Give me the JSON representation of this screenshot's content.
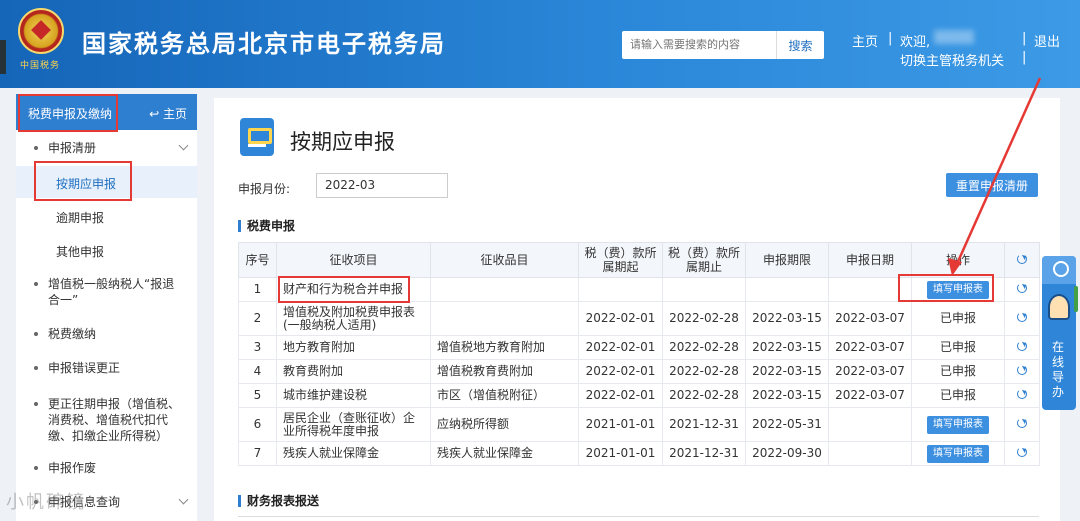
{
  "header": {
    "emblem_text": "中国税务",
    "site_title": "国家税务总局北京市电子税务局",
    "search_placeholder": "请输入需要搜索的内容",
    "search_button": "搜索",
    "home_link": "主页",
    "welcome": "欢迎,",
    "switch_authority": "切换主管税务机关",
    "logout": "退出",
    "separator": "|"
  },
  "sidebar": {
    "head_title": "税费申报及缴纳",
    "head_home": "主页",
    "items": [
      {
        "label": "申报清册"
      },
      {
        "label": "按期应申报"
      },
      {
        "label": "逾期申报"
      },
      {
        "label": "其他申报"
      },
      {
        "label": "增值税一般纳税人“报退合一”"
      },
      {
        "label": "税费缴纳"
      },
      {
        "label": "申报错误更正"
      },
      {
        "label": "更正往期申报（增值税、消费税、增值税代扣代缴、扣缴企业所得税）"
      },
      {
        "label": "申报作废"
      },
      {
        "label": "申报信息查询"
      }
    ],
    "watermark": "小帆碎镜"
  },
  "main": {
    "page_title": "按期应申报",
    "month_label": "申报月份:",
    "month_value": "2022-03",
    "reset_button": "重置申报清册",
    "section_tax": "税费申报",
    "section_finance": "财务报表报送",
    "columns": [
      "序号",
      "征收项目",
      "征收品目",
      "税（费）款所属期起",
      "税（费）款所属期止",
      "申报期限",
      "申报日期",
      "操作"
    ],
    "rows": [
      {
        "no": "1",
        "item": "财产和行为税合并申报",
        "sub": "",
        "start": "",
        "end": "",
        "deadline": "",
        "date": "",
        "action": "填写申报表",
        "action_type": "button"
      },
      {
        "no": "2",
        "item": "增值税及附加税费申报表(一般纳税人适用)",
        "sub": "",
        "start": "2022-02-01",
        "end": "2022-02-28",
        "deadline": "2022-03-15",
        "date": "2022-03-07",
        "action": "已申报",
        "action_type": "text"
      },
      {
        "no": "3",
        "item": "地方教育附加",
        "sub": "增值税地方教育附加",
        "start": "2022-02-01",
        "end": "2022-02-28",
        "deadline": "2022-03-15",
        "date": "2022-03-07",
        "action": "已申报",
        "action_type": "text"
      },
      {
        "no": "4",
        "item": "教育费附加",
        "sub": "增值税教育费附加",
        "start": "2022-02-01",
        "end": "2022-02-28",
        "deadline": "2022-03-15",
        "date": "2022-03-07",
        "action": "已申报",
        "action_type": "text"
      },
      {
        "no": "5",
        "item": "城市维护建设税",
        "sub": "市区（增值税附征）",
        "start": "2022-02-01",
        "end": "2022-02-28",
        "deadline": "2022-03-15",
        "date": "2022-03-07",
        "action": "已申报",
        "action_type": "text"
      },
      {
        "no": "6",
        "item": "居民企业（查账征收）企业所得税年度申报",
        "sub": "应纳税所得额",
        "start": "2021-01-01",
        "end": "2021-12-31",
        "deadline": "2022-05-31",
        "date": "",
        "action": "填写申报表",
        "action_type": "button"
      },
      {
        "no": "7",
        "item": "残疾人就业保障金",
        "sub": "残疾人就业保障金",
        "start": "2021-01-01",
        "end": "2021-12-31",
        "deadline": "2022-09-30",
        "date": "",
        "action": "填写申报表",
        "action_type": "button"
      }
    ]
  },
  "float_guide": {
    "label": "在线导办"
  },
  "colors": {
    "primary": "#2f7fd0",
    "highlight": "#e53935",
    "header_start": "#1565b8",
    "header_end": "#3c9ae6"
  }
}
